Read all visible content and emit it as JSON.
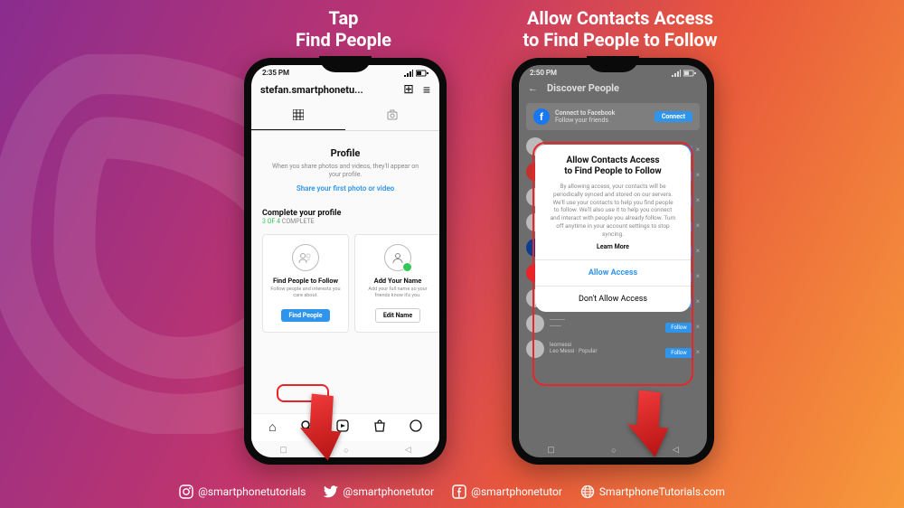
{
  "headings": {
    "left": "Tap\nFind People",
    "right": "Allow Contacts Access\nto Find People to Follow"
  },
  "phone1": {
    "status": {
      "time": "2:35 PM"
    },
    "header": {
      "username": "stefan.smartphonetu..."
    },
    "profile": {
      "title": "Profile",
      "desc": "When you share photos and videos, they'll appear on your profile.",
      "link": "Share your first photo or video"
    },
    "complete": {
      "title": "Complete your profile",
      "sub_a": "3 OF 4",
      "sub_b": " COMPLETE"
    },
    "cards": {
      "find": {
        "title": "Find People to Follow",
        "desc": "Follow people and interests you care about.",
        "btn": "Find People"
      },
      "name": {
        "title": "Add Your Name",
        "desc": "Add your full name so your friends know it's you.",
        "btn": "Edit Name"
      }
    }
  },
  "phone2": {
    "status": {
      "time": "2:50 PM"
    },
    "header": {
      "title": "Discover People"
    },
    "fb": {
      "title": "Connect to Facebook",
      "sub": "Follow your friends",
      "btn": "Connect"
    },
    "suggest": {
      "messi_name": "leomessi",
      "messi_sub": "Leo Messi · Popular"
    },
    "dialog": {
      "title": "Allow Contacts Access to Find People to Follow",
      "body": "By allowing access, your contacts will be periodically synced and stored on our servers. We'll use your contacts to help you find people to follow. We'll also use it to help you connect and interact with people you already follow. Turn off anytime in your account settings to stop syncing.",
      "learn": "Learn More",
      "allow": "Allow Access",
      "deny": "Don't Allow Access"
    }
  },
  "footer": {
    "ig": "@smartphonetutorials",
    "tw": "@smartphonetutor",
    "fb": "@smartphonetutor",
    "web": "SmartphoneTutorials.com"
  }
}
